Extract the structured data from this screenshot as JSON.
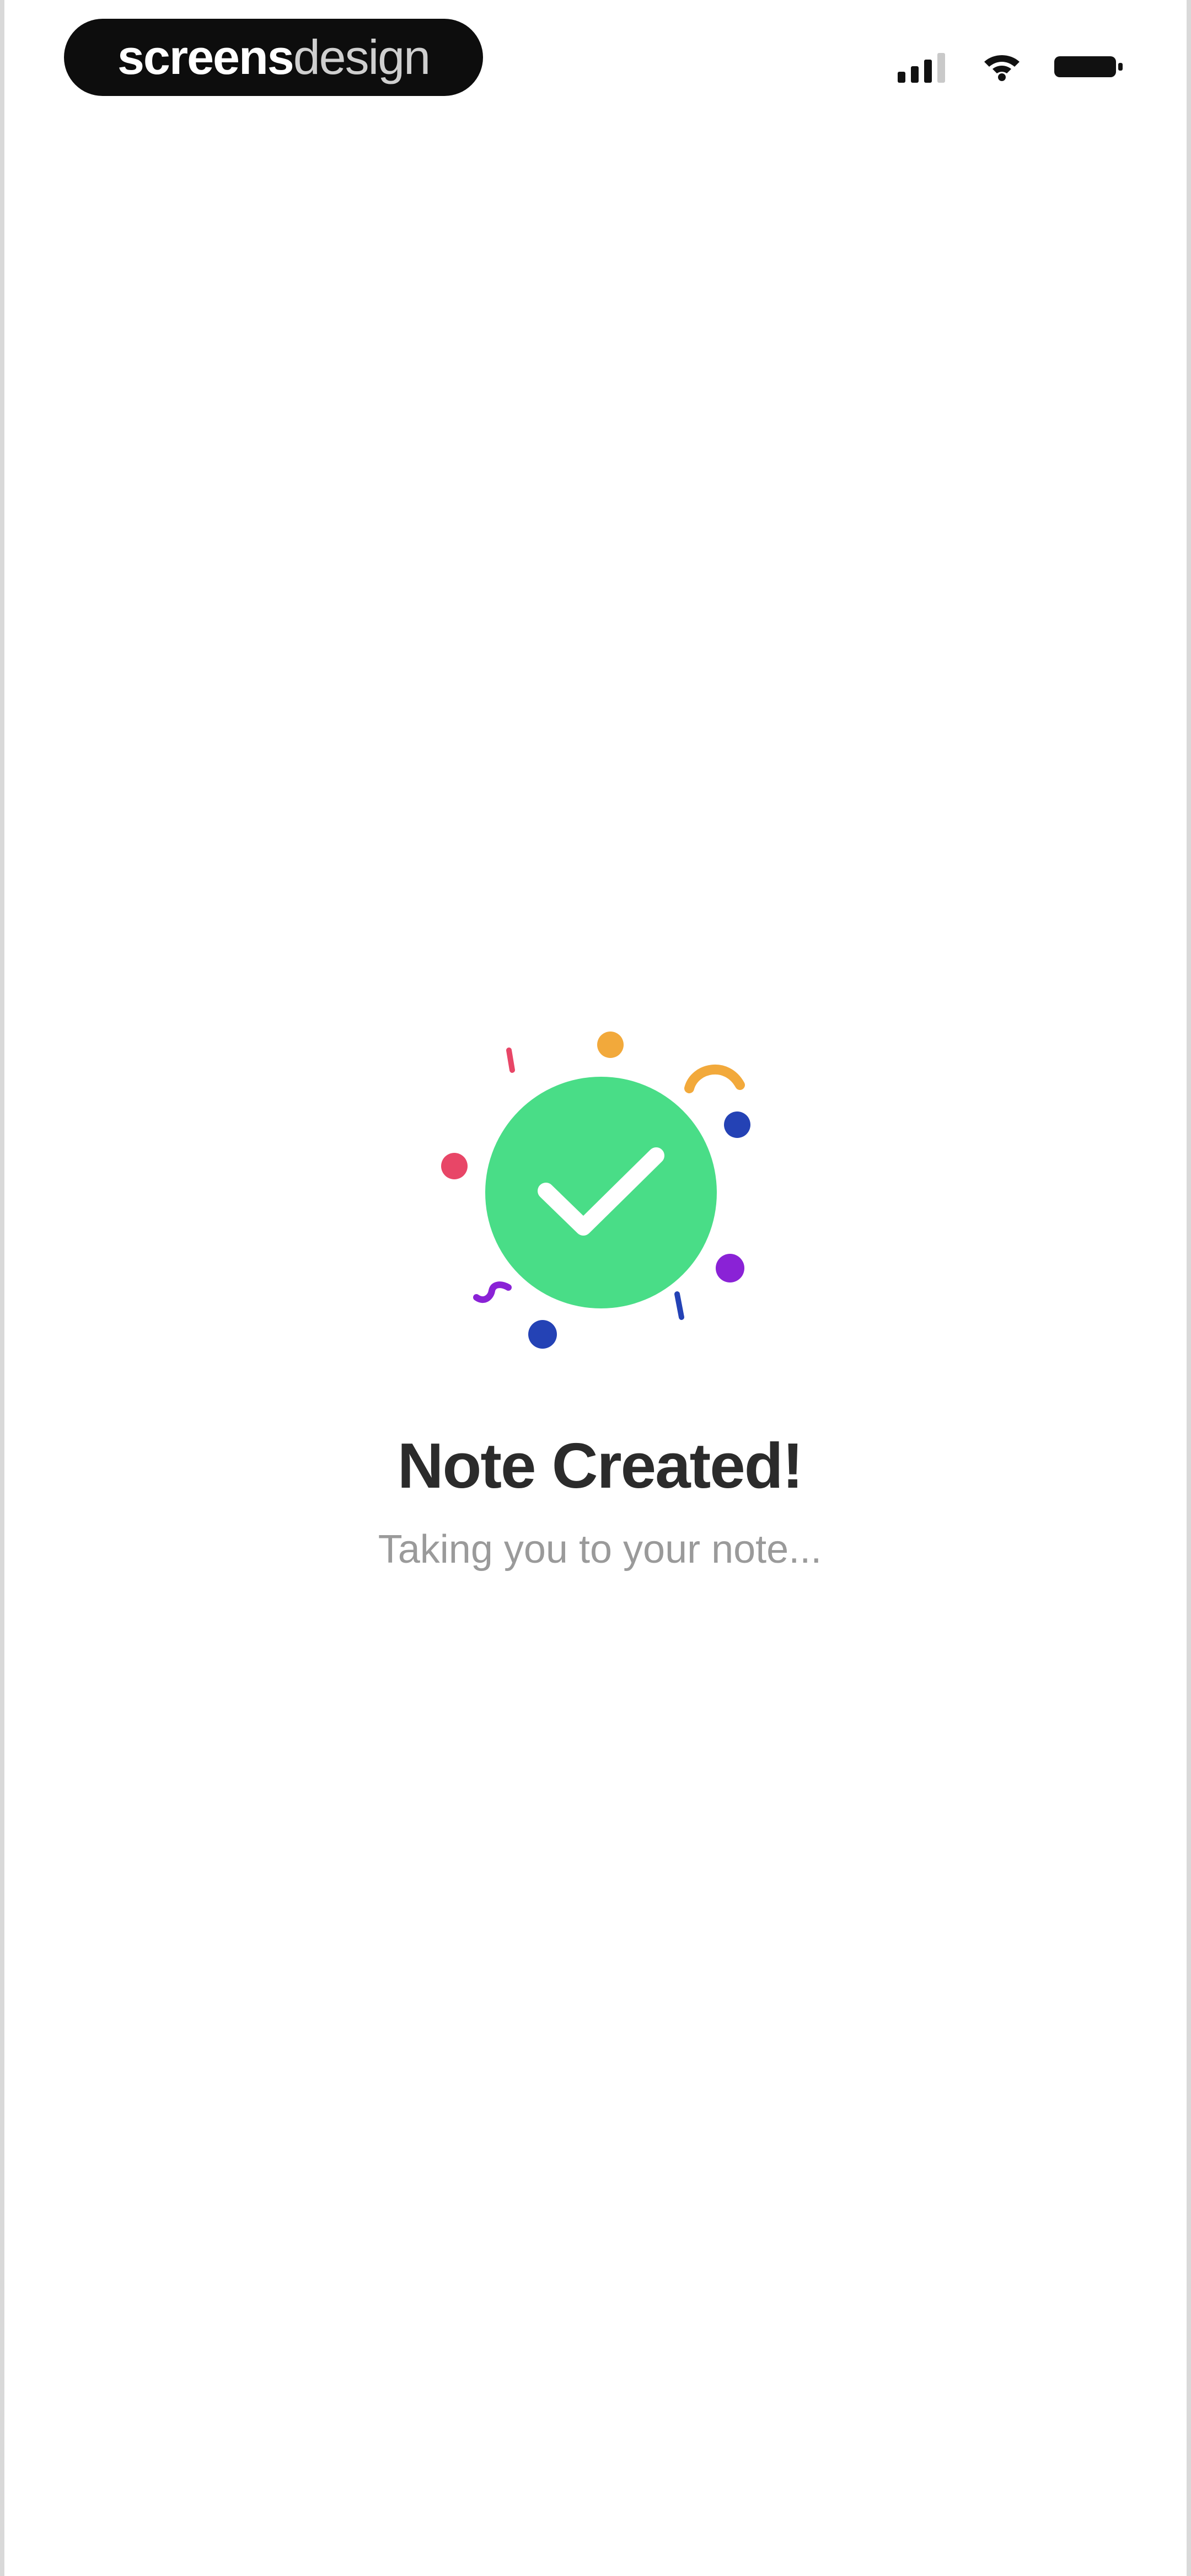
{
  "status_bar": {
    "brand_primary": "screens",
    "brand_secondary": "design",
    "signal_icon": "signal-icon",
    "wifi_icon": "wifi-icon",
    "battery_icon": "battery-icon"
  },
  "content": {
    "title": "Note Created!",
    "subtitle": "Taking you to your note..."
  },
  "colors": {
    "success": "#49dd87",
    "confetti_orange": "#f2a93b",
    "confetti_pink": "#e84667",
    "confetti_blue": "#2442b5",
    "confetti_purple": "#8a22d6"
  }
}
